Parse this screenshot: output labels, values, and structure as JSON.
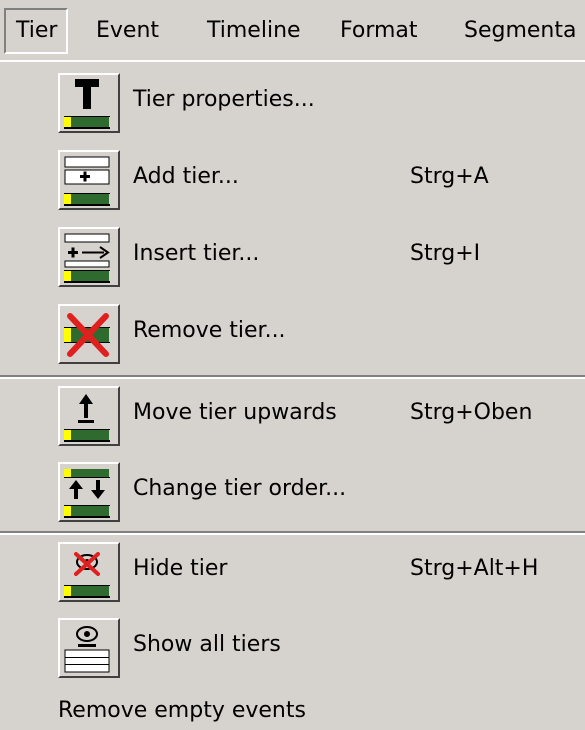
{
  "menubar": {
    "items": [
      {
        "label": "Tier"
      },
      {
        "label": "Event"
      },
      {
        "label": "Timeline"
      },
      {
        "label": "Format"
      },
      {
        "label": "Segmenta"
      }
    ]
  },
  "menu": {
    "items": [
      {
        "label": "Tier properties...",
        "shortcut": "",
        "icon": "tier-properties-icon"
      },
      {
        "label": "Add tier...",
        "shortcut": "Strg+A",
        "icon": "add-tier-icon"
      },
      {
        "label": "Insert tier...",
        "shortcut": "Strg+I",
        "icon": "insert-tier-icon"
      },
      {
        "label": "Remove tier...",
        "shortcut": "",
        "icon": "remove-tier-icon"
      },
      {
        "label": "Move tier upwards",
        "shortcut": "Strg+Oben",
        "icon": "move-tier-up-icon"
      },
      {
        "label": "Change tier order...",
        "shortcut": "",
        "icon": "change-tier-order-icon"
      },
      {
        "label": "Hide tier",
        "shortcut": "Strg+Alt+H",
        "icon": "hide-tier-icon"
      },
      {
        "label": "Show all tiers",
        "shortcut": "",
        "icon": "show-all-tiers-icon"
      },
      {
        "label": "Remove empty events",
        "shortcut": "",
        "icon": ""
      }
    ]
  },
  "colors": {
    "menu_bg": "#d6d3ce",
    "tier_green": "#2f6b2f",
    "tier_yellow": "#ffff00",
    "remove_red": "#e0201f"
  }
}
